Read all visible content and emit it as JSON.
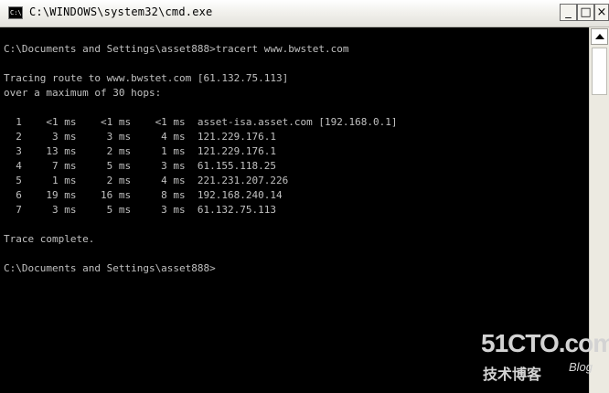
{
  "window": {
    "title": "C:\\WINDOWS\\system32\\cmd.exe",
    "icon_label": "C:\\",
    "buttons": {
      "minimize": "_",
      "maximize": "□",
      "close": "×"
    }
  },
  "console": {
    "lines": [
      "",
      "C:\\Documents and Settings\\asset888>tracert www.bwstet.com",
      "",
      "Tracing route to www.bwstet.com [61.132.75.113]",
      "over a maximum of 30 hops:",
      "",
      "  1    <1 ms    <1 ms    <1 ms  asset-isa.asset.com [192.168.0.1]",
      "  2     3 ms     3 ms     4 ms  121.229.176.1",
      "  3    13 ms     2 ms     1 ms  121.229.176.1",
      "  4     7 ms     5 ms     3 ms  61.155.118.25",
      "  5     1 ms     2 ms     4 ms  221.231.207.226",
      "  6    19 ms    16 ms     8 ms  192.168.240.14",
      "  7     3 ms     5 ms     3 ms  61.132.75.113",
      "",
      "Trace complete.",
      "",
      "C:\\Documents and Settings\\asset888>"
    ]
  },
  "watermark": {
    "site": "51CTO.com",
    "tagline": "技术博客",
    "blog": "Blog"
  },
  "colors": {
    "console_bg": "#000000",
    "console_text": "#c0c0c0",
    "titlebar": "#f2f1ed"
  }
}
